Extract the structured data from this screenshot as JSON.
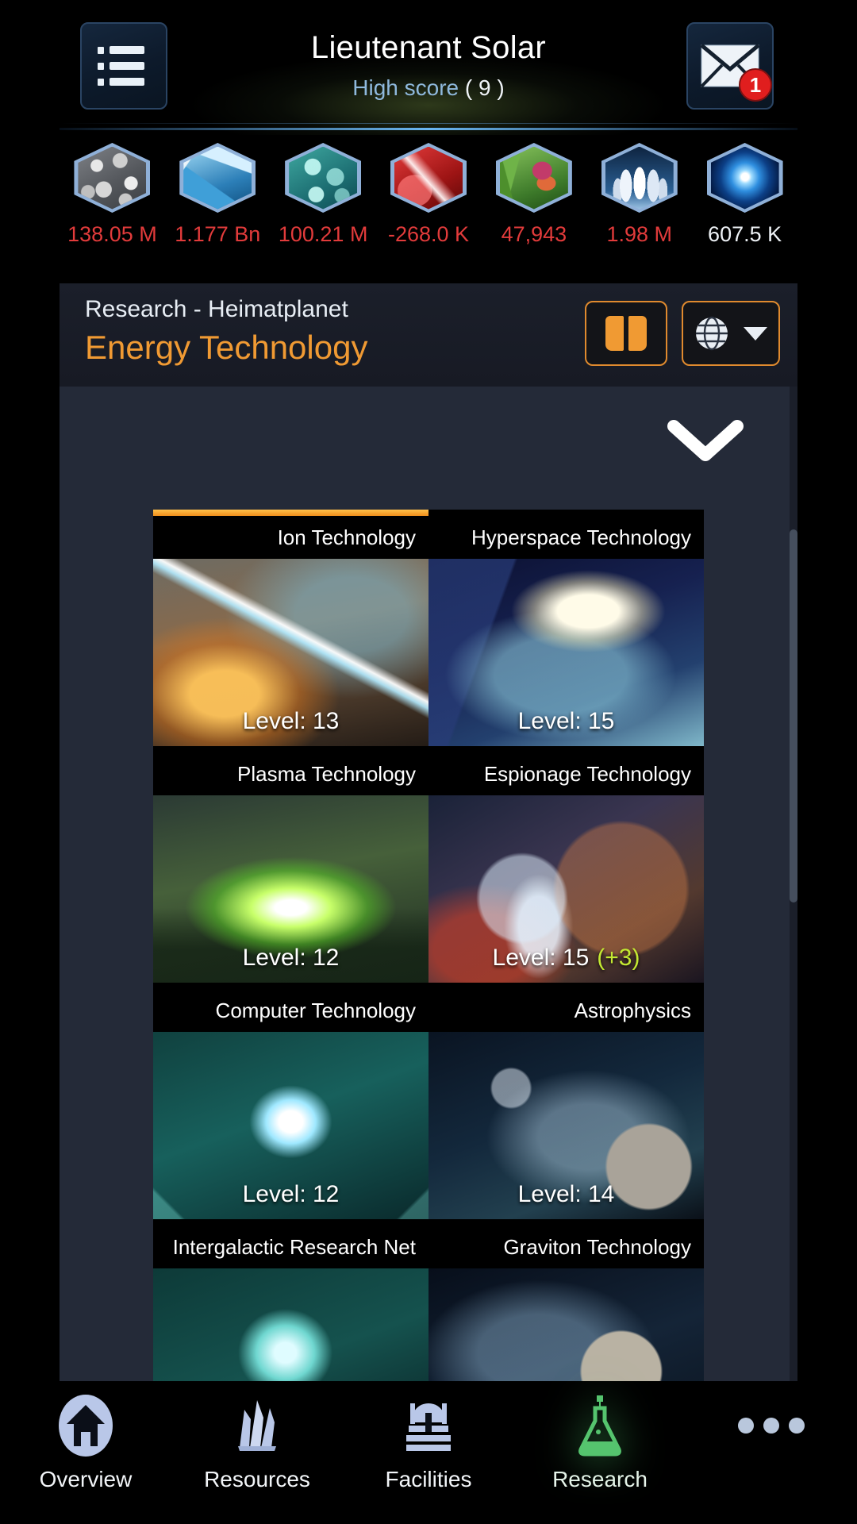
{
  "header": {
    "menu_icon": "menu-list-icon",
    "player_name": "Lieutenant Solar",
    "highscore_label": "High score",
    "highscore_value": "( 9 )",
    "mail_icon": "mail-envelope-icon",
    "mail_badge": "1"
  },
  "resources": [
    {
      "name": "metal",
      "icon": "metal-hex-icon",
      "value": "138.05 M",
      "negative": true
    },
    {
      "name": "crystal",
      "icon": "crystal-hex-icon",
      "value": "1.177 Bn",
      "negative": true
    },
    {
      "name": "deuterium",
      "icon": "deuterium-hex-icon",
      "value": "100.21 M",
      "negative": true
    },
    {
      "name": "energy",
      "icon": "energy-hex-icon",
      "value": "-268.0 K",
      "negative": true
    },
    {
      "name": "food",
      "icon": "food-hex-icon",
      "value": "47,943",
      "negative": true
    },
    {
      "name": "population",
      "icon": "population-hex-icon",
      "value": "1.98 M",
      "negative": true
    },
    {
      "name": "dark-matter",
      "icon": "dark-matter-hex-icon",
      "value": "607.5 K",
      "negative": false
    }
  ],
  "research_header": {
    "breadcrumb": "Research - Heimatplanet",
    "title": "Energy Technology",
    "book_button": "book-icon",
    "globe_button": "globe-icon",
    "globe_caret": "caret-down-icon"
  },
  "content": {
    "collapse_chevron": "chevron-down-icon"
  },
  "tech_grid": [
    [
      {
        "name": "Ion Technology",
        "level": "Level: 13",
        "bonus": "",
        "selected": true,
        "art": "a-ion"
      },
      {
        "name": "Hyperspace Technology",
        "level": "Level: 15",
        "bonus": "",
        "selected": false,
        "art": "a-hyper"
      }
    ],
    [
      {
        "name": "Plasma Technology",
        "level": "Level: 12",
        "bonus": "",
        "selected": false,
        "art": "a-plasma"
      },
      {
        "name": "Espionage Technology",
        "level": "Level: 15",
        "bonus": "(+3)",
        "selected": false,
        "art": "a-esp"
      }
    ],
    [
      {
        "name": "Computer Technology",
        "level": "Level: 12",
        "bonus": "",
        "selected": false,
        "art": "a-comp"
      },
      {
        "name": "Astrophysics",
        "level": "Level: 14",
        "bonus": "",
        "selected": false,
        "art": "a-astro"
      }
    ],
    [
      {
        "name": "Intergalactic Research Net",
        "level": "",
        "bonus": "",
        "selected": false,
        "art": "a-igrn"
      },
      {
        "name": "Graviton Technology",
        "level": "",
        "bonus": "",
        "selected": false,
        "art": "a-grav"
      }
    ]
  ],
  "bottom_nav": [
    {
      "label": "Overview",
      "icon": "home-icon",
      "active": false
    },
    {
      "label": "Resources",
      "icon": "crystals-icon",
      "active": false
    },
    {
      "label": "Facilities",
      "icon": "factory-icon",
      "active": false
    },
    {
      "label": "Research",
      "icon": "flask-icon",
      "active": true
    },
    {
      "label": "",
      "icon": "more-dots-icon",
      "active": false
    }
  ],
  "colors": {
    "accent_orange": "#f09a33",
    "resource_red": "#e23b3b",
    "bonus_green": "#c3e832",
    "badge_red": "#e01e1e",
    "content_bg": "#242a38"
  }
}
